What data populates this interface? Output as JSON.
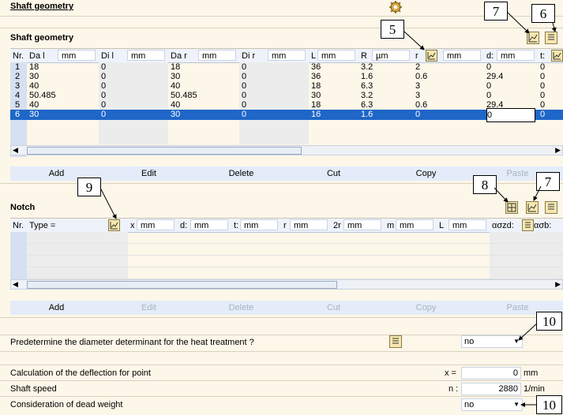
{
  "page": {
    "title": "Shaft geometry"
  },
  "shaft": {
    "title": "Shaft geometry",
    "columns": [
      {
        "label": "Nr.",
        "unit": ""
      },
      {
        "label": "Da l",
        "unit": "mm"
      },
      {
        "label": "Di l",
        "unit": "mm"
      },
      {
        "label": "Da r",
        "unit": "mm"
      },
      {
        "label": "Di r",
        "unit": "mm"
      },
      {
        "label": "L",
        "unit": "mm"
      },
      {
        "label": "R",
        "unit": "µm"
      },
      {
        "label": "r",
        "unit": "mm"
      },
      {
        "label": "d:",
        "unit": "mm"
      },
      {
        "label": "t:",
        "unit": ""
      }
    ],
    "rows": [
      [
        "1",
        "18",
        "0",
        "18",
        "0",
        "36",
        "3.2",
        "2",
        "0",
        "0"
      ],
      [
        "2",
        "30",
        "0",
        "30",
        "0",
        "36",
        "1.6",
        "0.6",
        "29.4",
        "0"
      ],
      [
        "3",
        "40",
        "0",
        "40",
        "0",
        "18",
        "6.3",
        "3",
        "0",
        "0"
      ],
      [
        "4",
        "50.485",
        "0",
        "50.485",
        "0",
        "30",
        "3.2",
        "3",
        "0",
        "0"
      ],
      [
        "5",
        "40",
        "0",
        "40",
        "0",
        "18",
        "6.3",
        "0.6",
        "29.4",
        "0"
      ],
      [
        "6",
        "30",
        "0",
        "30",
        "0",
        "16",
        "1.6",
        "0",
        "0",
        "0"
      ]
    ],
    "selected_row": 6,
    "buttons": {
      "add": "Add",
      "edit": "Edit",
      "delete": "Delete",
      "cut": "Cut",
      "copy": "Copy",
      "paste": "Paste"
    }
  },
  "notch": {
    "title": "Notch",
    "columns": [
      {
        "label": "Nr.",
        "unit": ""
      },
      {
        "label": "Type =",
        "unit": ""
      },
      {
        "label": "x",
        "unit": "mm"
      },
      {
        "label": "d:",
        "unit": "mm"
      },
      {
        "label": "t:",
        "unit": "mm"
      },
      {
        "label": "r",
        "unit": "mm"
      },
      {
        "label": "2r",
        "unit": "mm"
      },
      {
        "label": "m",
        "unit": "mm"
      },
      {
        "label": "L",
        "unit": "mm"
      },
      {
        "label": "ασzd:",
        "unit": ""
      },
      {
        "label": "ασb:",
        "unit": ""
      }
    ],
    "buttons": {
      "add": "Add",
      "edit": "Edit",
      "delete": "Delete",
      "cut": "Cut",
      "copy": "Copy",
      "paste": "Paste"
    }
  },
  "heat_treatment": {
    "label": "Predetermine the diameter determinant for the heat treatment ?",
    "value": "no"
  },
  "deflection": {
    "label": "Calculation of the deflection for point",
    "var": "x =",
    "value": "0",
    "unit": "mm"
  },
  "speed": {
    "label": "Shaft speed",
    "var": "n :",
    "value": "2880",
    "unit": "1/min"
  },
  "dead_weight": {
    "label": "Consideration of dead weight",
    "value": "no"
  },
  "callouts": {
    "c5": "5",
    "c6": "6",
    "c7a": "7",
    "c7b": "7",
    "c8": "8",
    "c9": "9",
    "c10a": "10",
    "c10b": "10"
  },
  "colors": {
    "selection": "#1e66c8",
    "background": "#fdf7e9",
    "header": "#eef3fb"
  }
}
